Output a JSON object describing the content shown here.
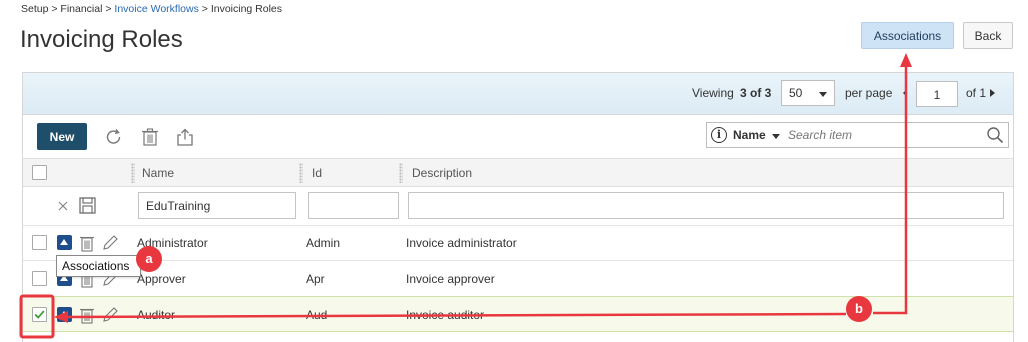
{
  "breadcrumb": {
    "setup": "Setup",
    "sep1": " > ",
    "financial": "Financial",
    "sep2": " > ",
    "invoice_workflows": "Invoice Workflows",
    "sep3": " > ",
    "current": "Invoicing Roles"
  },
  "title": "Invoicing Roles",
  "header_buttons": {
    "associations": "Associations",
    "back": "Back"
  },
  "pager": {
    "viewing_label": "Viewing",
    "viewing_count": "3 of 3",
    "per_page_value": "50",
    "per_page_label": "per page",
    "page_value": "1",
    "of_pages": "of 1"
  },
  "toolbar": {
    "new_label": "New",
    "icons": [
      "refresh-icon",
      "trash-icon",
      "export-icon"
    ]
  },
  "search": {
    "info_glyph": "i",
    "field": "Name",
    "placeholder": "Search item"
  },
  "columns": {
    "name": "Name",
    "id": "Id",
    "description": "Description"
  },
  "filter": {
    "name_value": "EduTraining",
    "id_value": "",
    "description_value": ""
  },
  "rows": [
    {
      "name": "Administrator",
      "id": "Admin",
      "description": "Invoice administrator",
      "checked": false
    },
    {
      "name": "Approver",
      "id": "Apr",
      "description": "Invoice approver",
      "checked": false
    },
    {
      "name": "Auditor",
      "id": "Aud",
      "description": "Invoice auditor",
      "checked": true
    }
  ],
  "tooltip": "Associations",
  "annotations": {
    "a": "a",
    "b": "b"
  },
  "colors": {
    "primary": "#1f4e6b",
    "associations_button": "#cfe3f6",
    "annotation": "#e8373f",
    "check": "#3a9b2f"
  }
}
